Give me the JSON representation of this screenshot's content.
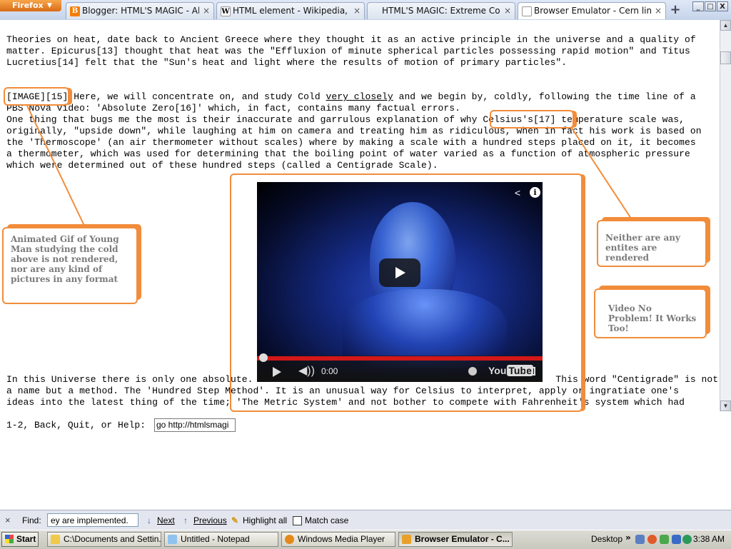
{
  "browser": {
    "menu_button": "Firefox",
    "tabs": [
      {
        "label": "Blogger: HTML'S MAGIC - All posts",
        "icon": "blogger-icon",
        "active": false
      },
      {
        "label": "HTML element - Wikipedia, the fr...",
        "icon": "wikipedia-icon",
        "active": false
      },
      {
        "label": "HTML'S MAGIC: Extreme Cold: A ...",
        "icon": "blank-page-icon",
        "active": false
      },
      {
        "label": "Browser Emulator - Cern line mo...",
        "icon": "blank-page-icon",
        "active": true
      }
    ],
    "new_tab": "+",
    "window_controls": {
      "minimize": "_",
      "maximize": "□",
      "close": "X"
    }
  },
  "page": {
    "lines_top": [
      "Theories on heat, date back to Ancient Greece where they thought it as an active principle in the universe and a quality of",
      "matter. Epicurus[13] thought that heat was the \"Effluxion of minute spherical particles possessing rapid motion\" and Titus",
      "Lucretius[14] felt that the \"Sun's heat and light where the results of motion of primary particles\"."
    ],
    "para2": {
      "l1_a": "[IMAGE][15] Here, we will concentrate on, and study Cold ",
      "l1_link": "very closely",
      "l1_b": " and we begin by, coldly, following the time line of a",
      "l2": "PBS Nova video: 'Absolute Zero[16]' which, in fact, contains many factual errors.",
      "l3": "One thing that bugs me the most is their inaccurate and garrulous explanation of why Celsius's[17] temperature scale was,",
      "l4": "originally, \"upside down\", while laughing at him on camera and treating him as ridiculous, when in fact his work is based on",
      "l5": "the 'Thermoscope' (an air thermometer without scales) where by making a scale with a hundred steps placed on it, it becomes",
      "l6": "a thermometer, which was used for determining that the boiling point of water varied as a function of atmospheric pressure",
      "l7": "which were determined out of these hundred steps (called a Centigrade Scale)."
    },
    "lines_bottom": [
      "In this Universe there is only one absolute.                                                      This word \"Centigrade\" is not",
      "a name but a method. The 'Hundred Step Method'. It is an unusual way for Celsius to interpret, apply or ingratiate one's",
      "ideas into the latest thing of the time; 'The Metric System' and not bother to compete with Fahrenheit's system which had"
    ],
    "prompt_text": "1-2, Back, Quit, or Help:",
    "command_value": "go http://htmlsmagi"
  },
  "video": {
    "time": "0:00",
    "brand": "You",
    "brand_tube": "Tube",
    "progress_fraction": 0.0
  },
  "callouts": {
    "image_note": "Animated  Gif of Young Man studying the cold above is not rendered, nor are any kind of pictures in any format",
    "entities_note": "Neither are any entites are rendered",
    "video_note": "Video No Problem! It Works Too!"
  },
  "findbar": {
    "close": "×",
    "label": "Find:",
    "value": "ey are implemented.",
    "next": "Next",
    "previous": "Previous",
    "highlight": "Highlight all",
    "match_case": "Match case"
  },
  "taskbar": {
    "start": "Start",
    "tasks": [
      {
        "label": "C:\\Documents and Settin...",
        "active": false
      },
      {
        "label": "Untitled - Notepad",
        "active": false
      },
      {
        "label": "Windows Media Player",
        "active": false
      },
      {
        "label": "Browser Emulator - C...",
        "active": true
      }
    ],
    "desktop": "Desktop",
    "tray_arrow": "»",
    "clock": "3:38 AM"
  },
  "colors": {
    "callout_orange": "#f28c3a",
    "callout_text": "#7a7a7a",
    "progress_red": "#d21818"
  }
}
